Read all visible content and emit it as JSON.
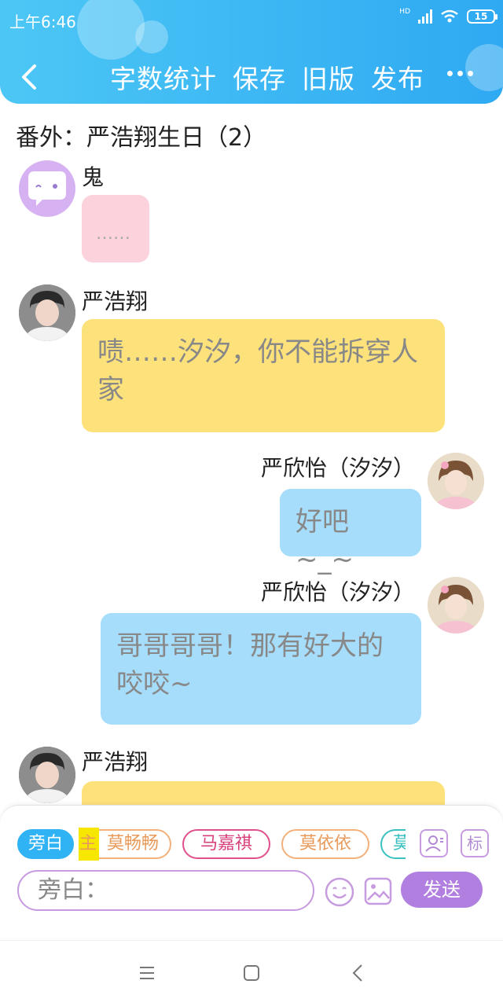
{
  "status_bar": {
    "time": "上午6:46",
    "network": "HD",
    "battery": "15"
  },
  "toolbar": {
    "back_icon": "chevron-left-icon",
    "actions": [
      "字数统计",
      "保存",
      "旧版",
      "发布"
    ],
    "more_icon": "more-dots-icon",
    "color": "#33b0f3"
  },
  "story_title": "番外：严浩翔生日（2）",
  "messages": [
    {
      "side": "left",
      "name": "鬼",
      "text": "……",
      "bubble_color": "#fcd2dc",
      "avatar": "ghost-chat-avatar"
    },
    {
      "side": "left",
      "name": "严浩翔",
      "text": "啧……汐汐，你不能拆穿人家",
      "bubble_color": "#fde17a",
      "avatar": "boy-photo-avatar"
    },
    {
      "side": "right",
      "name": "严欣怡（汐汐）",
      "text": "好吧~_~",
      "bubble_color": "#a6ddfb",
      "avatar": "girl-photo-avatar"
    },
    {
      "side": "right",
      "name": "严欣怡（汐汐）",
      "text": "哥哥哥哥！那有好大的咬咬~",
      "bubble_color": "#a6ddfb",
      "avatar": "girl-photo-avatar"
    },
    {
      "side": "left",
      "name": "严浩翔",
      "text": "",
      "bubble_color": "#fde17a",
      "avatar": "boy-photo-avatar"
    }
  ],
  "composer": {
    "roles": [
      "旁白",
      "主",
      "莫畅畅",
      "马嘉祺",
      "莫依依",
      "莫"
    ],
    "role_icon": "person-card-icon",
    "tag_label": "标",
    "input_placeholder": "旁白：",
    "emoji_icon": "smiley-icon",
    "image_icon": "image-icon",
    "send_label": "发送",
    "accent": "#b17fe0"
  },
  "system_nav": {
    "icons": [
      "menu-icon",
      "home-square-icon",
      "back-triangle-icon"
    ]
  }
}
